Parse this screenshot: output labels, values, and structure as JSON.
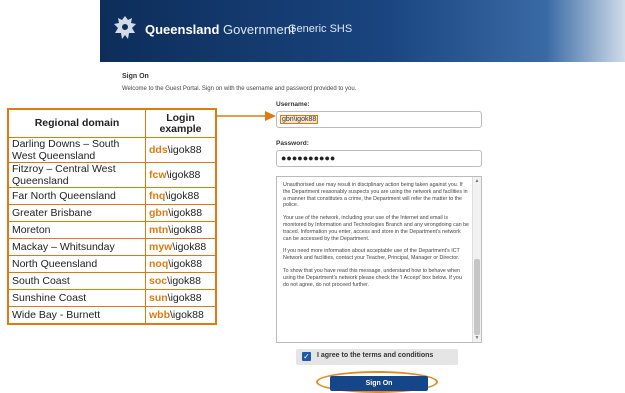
{
  "header": {
    "brand_bold": "Queensland",
    "brand_light": "Government",
    "portal_name": "Generic SHS"
  },
  "form": {
    "title": "Sign On",
    "welcome": "Welcome to the Guest Portal. Sign on with the username and password provided to you.",
    "username_label": "Username:",
    "username_value": "gbn\\igok88",
    "password_label": "Password:",
    "password_mask": "●●●●●●●●●●",
    "terms": [
      "Unauthorised use may result in disciplinary action being taken against you. If the Department reasonably suspects you are using the network and facilities in a manner that constitutes a crime, the Department will refer the matter to the police.",
      "Your use of the network, including your use of the Internet and email is monitored by Information and Technologies Branch and any wrongdoing can be traced. Information you enter, access and store in the Department's network can be accessed by the Department.",
      "If you need more information about acceptable use of the Department's ICT Network and facilities, contact your Teacher, Principal, Manager or Director.",
      "To show that you have read this message, understand how to behave when using the Department's network please check the 'I Accept' box below. If you do not agree, do not proceed further."
    ],
    "agree_label": "I agree to the terms and conditions",
    "agree_checked": true,
    "signon_button": "Sign On"
  },
  "domain_table": {
    "headers": [
      "Regional domain",
      "Login example"
    ],
    "rows": [
      {
        "region": "Darling Downs – South West Queensland",
        "prefix": "dds",
        "suffix": "\\igok88"
      },
      {
        "region": "Fitzroy – Central West Queensland",
        "prefix": "fcw",
        "suffix": "\\igok88"
      },
      {
        "region": "Far North Queensland",
        "prefix": "fnq",
        "suffix": "\\igok88"
      },
      {
        "region": "Greater Brisbane",
        "prefix": "gbn",
        "suffix": "\\igok88"
      },
      {
        "region": "Moreton",
        "prefix": "mtn",
        "suffix": "\\igok88"
      },
      {
        "region": "Mackay – Whitsunday",
        "prefix": "myw",
        "suffix": "\\igok88"
      },
      {
        "region": "North Queensland",
        "prefix": "noq",
        "suffix": "\\igok88"
      },
      {
        "region": "South Coast",
        "prefix": "soc",
        "suffix": "\\igok88"
      },
      {
        "region": "Sunshine Coast",
        "prefix": "sun",
        "suffix": "\\igok88"
      },
      {
        "region": "Wide Bay - Burnett",
        "prefix": "wbb",
        "suffix": "\\igok88"
      }
    ]
  },
  "colors": {
    "highlight": "#e07a10",
    "banner_dark": "#0d2d5a",
    "button": "#16468a"
  },
  "icons": {
    "crest": "queensland-crest-icon",
    "checkbox": "checkbox-checked-icon",
    "arrow": "arrow-right-icon"
  }
}
